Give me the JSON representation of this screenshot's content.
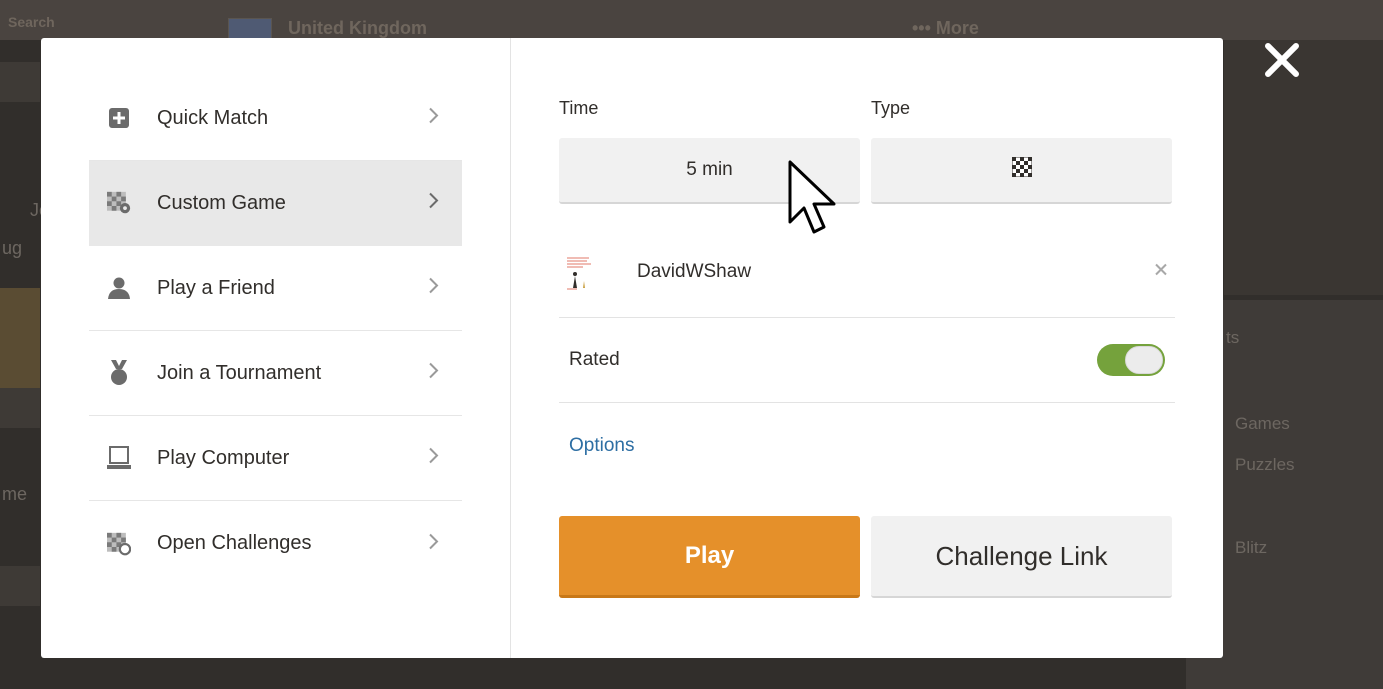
{
  "background": {
    "nav_search": "Search",
    "nav_country": "United Kingdom",
    "nav_more": "More",
    "right_panel": {
      "heading_fragment": "ts",
      "item_games": "Games",
      "item_puzzles": "Puzzles",
      "item_blitz": "Blitz"
    },
    "left_fragments": [
      "Jo",
      "ug",
      "me"
    ]
  },
  "menu": {
    "items": [
      {
        "label": "Quick Match",
        "icon": "plus-square-icon",
        "active": false
      },
      {
        "label": "Custom Game",
        "icon": "board-gear-icon",
        "active": true
      },
      {
        "label": "Play a Friend",
        "icon": "person-icon",
        "active": false
      },
      {
        "label": "Join a Tournament",
        "icon": "medal-icon",
        "active": false
      },
      {
        "label": "Play Computer",
        "icon": "laptop-icon",
        "active": false
      },
      {
        "label": "Open Challenges",
        "icon": "board-circle-icon",
        "active": false
      }
    ]
  },
  "settings": {
    "time_label": "Time",
    "type_label": "Type",
    "time_value": "5 min",
    "type_icon": "checkerboard-icon"
  },
  "opponent": {
    "name": "DavidWShaw",
    "remove_icon": "close-icon"
  },
  "rated": {
    "label": "Rated",
    "enabled": true
  },
  "options_label": "Options",
  "actions": {
    "play_label": "Play",
    "challenge_link_label": "Challenge Link"
  },
  "colors": {
    "play": "#e5902a",
    "toggle_on": "#75a23c",
    "link": "#2d6ea3",
    "active_item": "#e8e8e8"
  }
}
